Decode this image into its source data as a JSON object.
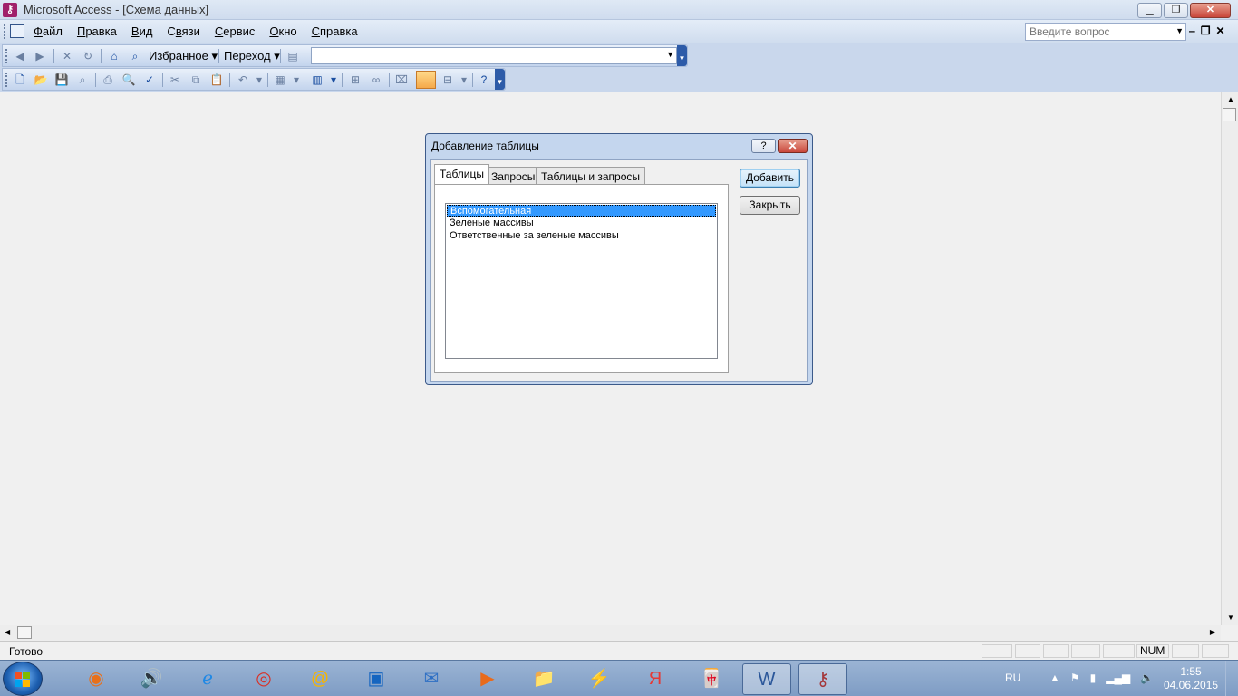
{
  "window": {
    "title": "Microsoft Access - [Схема данных]",
    "controls": {
      "minimize": "▁",
      "restore": "❐",
      "close": "✕"
    }
  },
  "menu": {
    "items": [
      {
        "pre": "",
        "u": "Ф",
        "post": "айл"
      },
      {
        "pre": "",
        "u": "П",
        "post": "равка"
      },
      {
        "pre": "",
        "u": "В",
        "post": "ид"
      },
      {
        "pre": "С",
        "u": "в",
        "post": "язи"
      },
      {
        "pre": "",
        "u": "С",
        "post": "ервис"
      },
      {
        "pre": "",
        "u": "О",
        "post": "кно"
      },
      {
        "pre": "",
        "u": "С",
        "post": "правка"
      }
    ],
    "ask_placeholder": "Введите вопрос",
    "mdi": {
      "minimize": "‒",
      "restore": "❐",
      "close": "✕"
    }
  },
  "toolbar_web": {
    "favorites": "Избранное",
    "goto": "Переход",
    "address_value": ""
  },
  "toolbar_main": {},
  "dialog": {
    "title": "Добавление таблицы",
    "help": "?",
    "close": "✕",
    "tabs": [
      "Таблицы",
      "Запросы",
      "Таблицы и запросы"
    ],
    "active_tab": "Таблицы",
    "tables": [
      {
        "name": "Вспомогательная",
        "selected": true
      },
      {
        "name": "Зеленые массивы",
        "selected": false
      },
      {
        "name": "Ответственные за зеленые массивы",
        "selected": false
      }
    ],
    "add_button": "Добавить",
    "close_button": "Закрыть"
  },
  "status": {
    "text": "Готово",
    "num": "NUM"
  },
  "taskbar": {
    "language": "RU",
    "time": "1:55",
    "date": "04.06.2015",
    "apps": [
      "firefox",
      "speaker",
      "internet-explorer",
      "chrome",
      "mail-ru-agent",
      "maxthon",
      "mail",
      "media-player",
      "file-explorer",
      "winamp",
      "yandex",
      "mahjong",
      "word",
      "access"
    ]
  },
  "colors": {
    "titlebar": "#dfe9f5",
    "workspace": "#f0f0f0",
    "selection": "#3399ff",
    "dialog_frame": "#c4d6ee"
  }
}
